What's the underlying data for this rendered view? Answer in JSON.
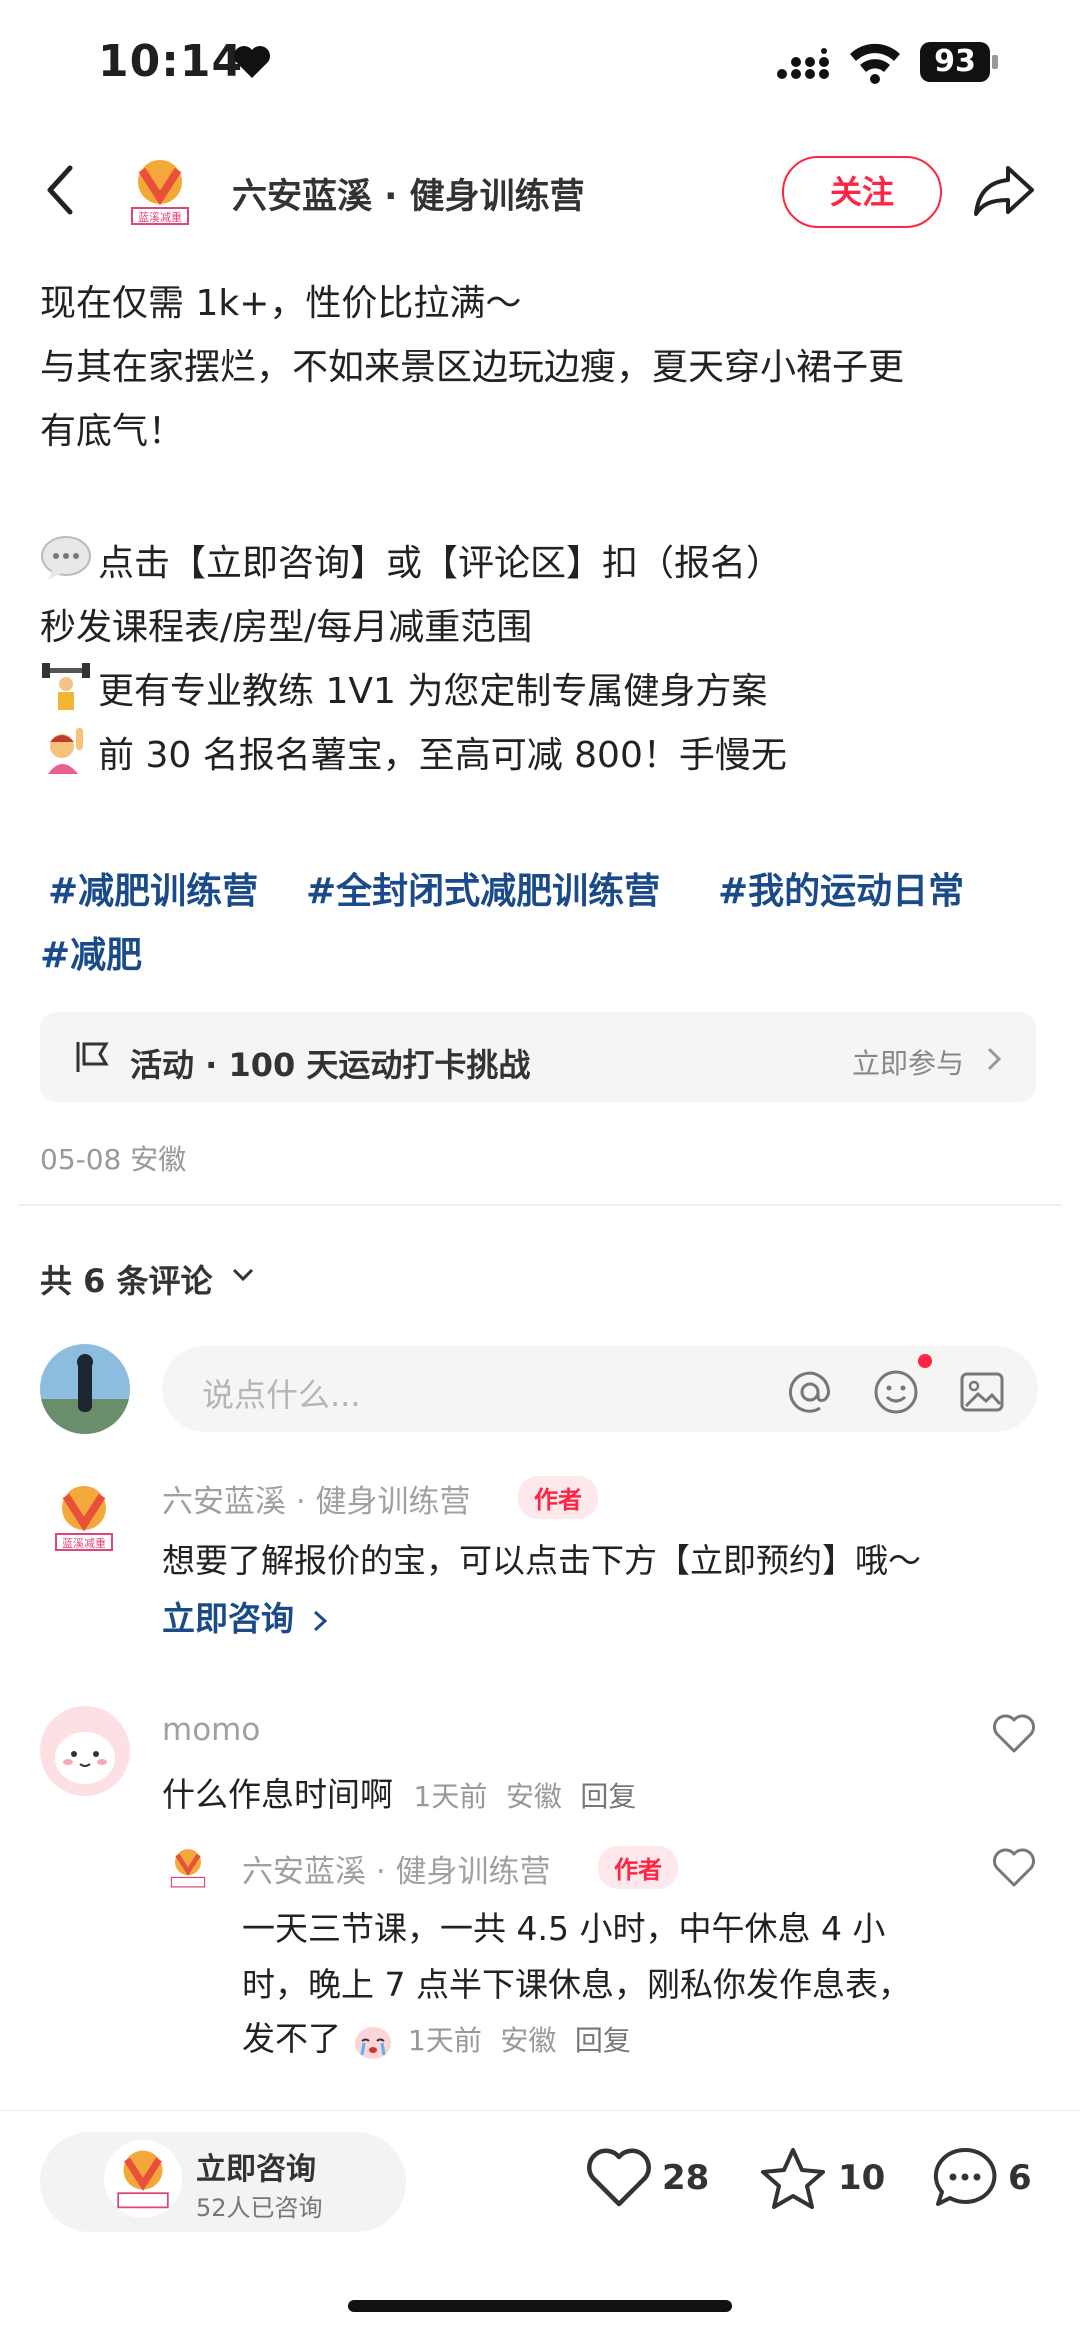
{
  "status_bar": {
    "time": "10:14",
    "battery": "93"
  },
  "header": {
    "author": "六安蓝溪 · 健身训练营",
    "follow_label": "关注",
    "logo_text": "蓝溪减重"
  },
  "post": {
    "lines": [
      "现在仅需 1k+，性价比拉满～",
      "与其在家摆烂，不如来景区边玩边瘦，夏天穿小裙子更",
      "有底气！",
      "点击【立即咨询】或【评论区】扣（报名）",
      "秒发课程表/房型/每月减重范围",
      "更有专业教练 1V1 为您定制专属健身方案",
      "前 30 名报名薯宝，至高可减 800！手慢无"
    ],
    "tags": [
      "#减肥训练营",
      "#全封闭式减肥训练营",
      "#我的运动日常",
      "#减肥"
    ],
    "activity_label": "活动 · 100 天运动打卡挑战",
    "activity_action": "立即参与",
    "meta": "05-08 安徽"
  },
  "comments_section": {
    "count_label": "共 6 条评论",
    "input_placeholder": "说点什么..."
  },
  "comments": [
    {
      "name": "六安蓝溪 · 健身训练营",
      "badge": "作者",
      "text": "想要了解报价的宝，可以点击下方【立即预约】哦～",
      "link": "立即咨询"
    },
    {
      "name": "momo",
      "text": "什么作息时间啊",
      "time": "1天前",
      "location": "安徽",
      "reply": "回复"
    },
    {
      "name": "六安蓝溪 · 健身训练营",
      "badge": "作者",
      "text_lines": [
        "一天三节课，一共 4.5 小时，中午休息 4 小",
        "时，晚上 7 点半下课休息，刚私你发作息表，",
        "发不了"
      ],
      "time": "1天前",
      "location": "安徽",
      "reply": "回复"
    }
  ],
  "bottom_bar": {
    "consult_label": "立即咨询",
    "consult_count": "52人已咨询",
    "likes": "28",
    "favorites": "10",
    "comments": "6"
  },
  "colors": {
    "accent": "#ff2442",
    "tag": "#1a4a8a"
  }
}
